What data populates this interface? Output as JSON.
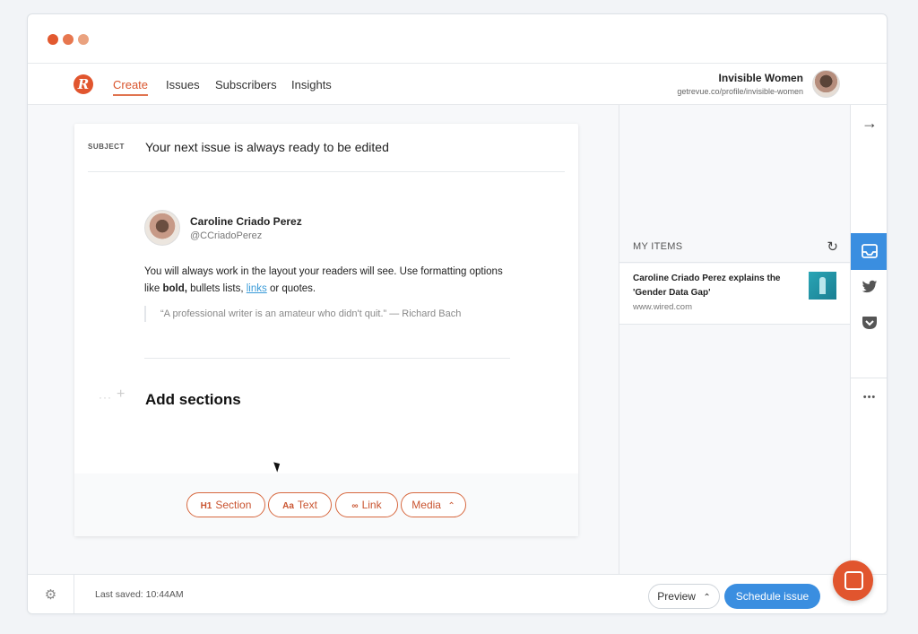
{
  "nav": {
    "logo": "R",
    "links": [
      "Create",
      "Issues",
      "Subscribers",
      "Insights"
    ]
  },
  "profile": {
    "name": "Invisible Women",
    "url": "getrevue.co/profile/invisible-women"
  },
  "editor": {
    "subject_label": "SUBJECT",
    "subject_value": "Your next issue is always ready to be edited",
    "tweet": {
      "name": "Caroline Criado Perez",
      "handle": "@CCriadoPerez"
    },
    "body": {
      "part1": "You will always work in the layout your readers will see. Use formatting options like ",
      "bold": "bold,",
      "part2": " bullets lists, ",
      "link": "links",
      "part3": " or quotes."
    },
    "quote": "“A professional writer is an amateur who didn't quit.” — Richard Bach",
    "add_sections": "Add sections",
    "toolbar": {
      "section": {
        "icon": "H1",
        "label": "Section"
      },
      "text": {
        "icon": "Aa",
        "label": "Text"
      },
      "link": {
        "icon": "🔗",
        "label": "Link"
      },
      "media": {
        "label": "Media",
        "caret": "^"
      }
    }
  },
  "right_panel": {
    "my_items_label": "MY ITEMS",
    "items": [
      {
        "title": "Caroline Criado Perez explains the 'Gender Data Gap'",
        "source": "www.wired.com"
      }
    ]
  },
  "rail": {
    "arrow": "→",
    "twitter": "🐦",
    "more": "•••"
  },
  "footer": {
    "last_saved": "Last saved: 10:44AM",
    "preview": "Preview",
    "schedule": "Schedule issue"
  },
  "colors": {
    "accent": "#e1552e",
    "blue": "#3a8ee0"
  }
}
